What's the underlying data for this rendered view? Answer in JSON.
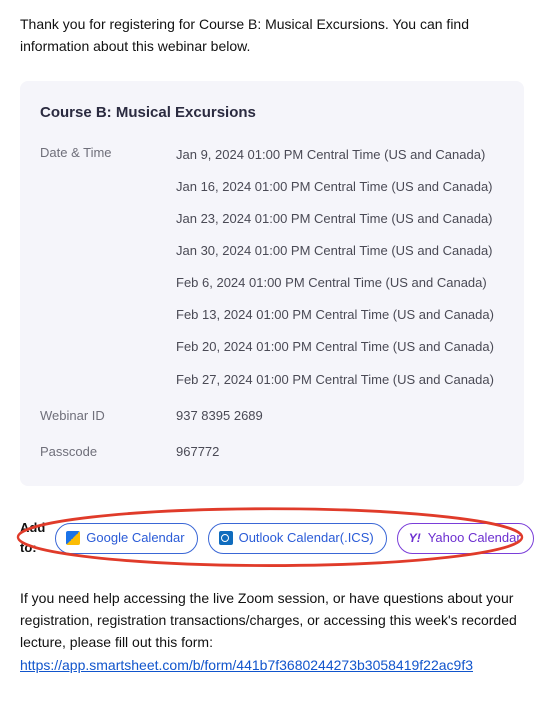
{
  "intro": "Thank you for registering for Course B: Musical Excursions. You can find information about this webinar below.",
  "course": {
    "title": "Course B: Musical Excursions",
    "date_label": "Date & Time",
    "dates": [
      "Jan 9, 2024 01:00 PM Central Time (US and Canada)",
      "Jan 16, 2024 01:00 PM Central Time (US and Canada)",
      "Jan 23, 2024 01:00 PM Central Time (US and Canada)",
      "Jan 30, 2024 01:00 PM Central Time (US and Canada)",
      "Feb 6, 2024 01:00 PM Central Time (US and Canada)",
      "Feb 13, 2024 01:00 PM Central Time (US and Canada)",
      "Feb 20, 2024 01:00 PM Central Time (US and Canada)",
      "Feb 27, 2024 01:00 PM Central Time (US and Canada)"
    ],
    "webinar_id_label": "Webinar ID",
    "webinar_id": "937 8395 2689",
    "passcode_label": "Passcode",
    "passcode": "967772"
  },
  "add_to": {
    "label": "Add to:",
    "buttons": [
      {
        "icon": "google-calendar-icon",
        "label": "Google Calendar"
      },
      {
        "icon": "outlook-calendar-icon",
        "label": "Outlook Calendar(.ICS)"
      },
      {
        "icon": "yahoo-calendar-icon",
        "label": "Yahoo Calendar"
      }
    ]
  },
  "help": {
    "text": "If you need help accessing the live Zoom session, or have questions about your registration, registration transactions/charges, or accessing this week's recorded lecture, please fill out this form:",
    "link": "https://app.smartsheet.com/b/form/441b7f3680244273b3058419f22ac9f3"
  }
}
